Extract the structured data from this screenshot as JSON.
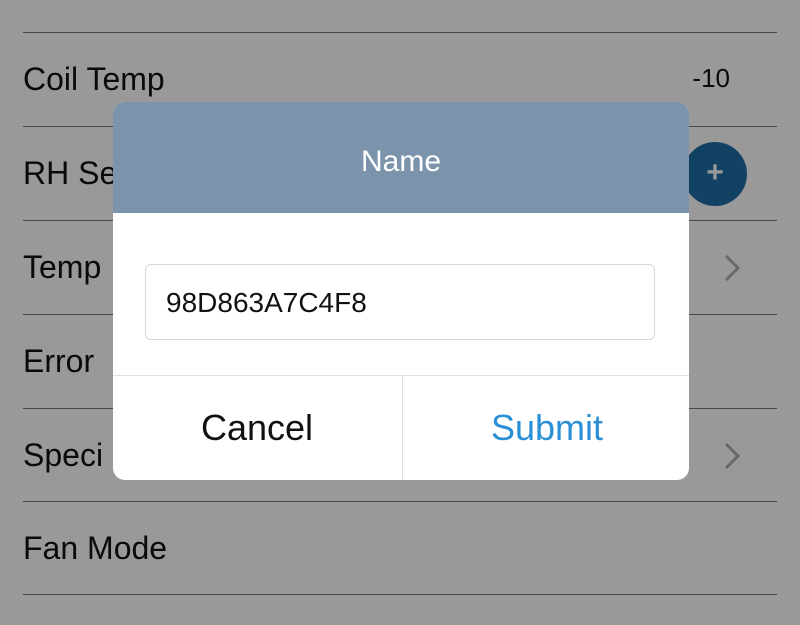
{
  "settings_rows": [
    {
      "label": "",
      "value": ""
    },
    {
      "label": "Coil Temp",
      "value": "-10"
    },
    {
      "label": "RH Se",
      "value": ""
    },
    {
      "label": "Temp",
      "value": ""
    },
    {
      "label": "Error",
      "value": ""
    },
    {
      "label": "Speci",
      "value": ""
    },
    {
      "label": "Fan Mode",
      "value": ""
    }
  ],
  "add_button_symbol": "+",
  "dialog": {
    "title": "Name",
    "input_value": "98D863A7C4F8",
    "cancel_label": "Cancel",
    "submit_label": "Submit"
  },
  "colors": {
    "dialog_header": "#7c93ac",
    "submit_text": "#2a8fd6",
    "add_button": "#1f6fa5"
  }
}
